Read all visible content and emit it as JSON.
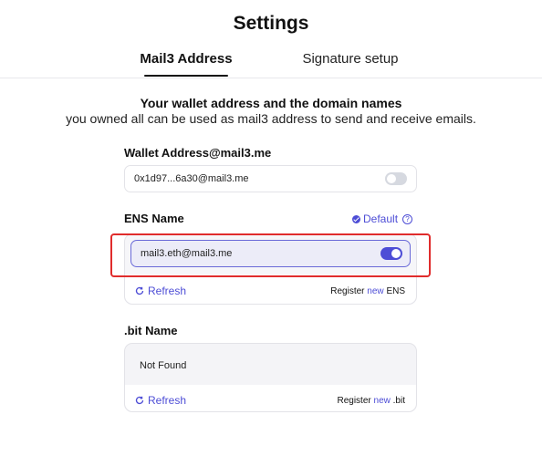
{
  "header": {
    "title": "Settings"
  },
  "tabs": [
    {
      "label": "Mail3 Address",
      "active": true
    },
    {
      "label": "Signature setup",
      "active": false
    }
  ],
  "intro": {
    "title": "Your wallet address and the domain names",
    "subtitle": "you owned all can be used as mail3 address to send and receive emails."
  },
  "wallet": {
    "label": "Wallet Address@mail3.me",
    "address": "0x1d97...6a30@mail3.me",
    "toggle_on": false
  },
  "ens": {
    "label": "ENS Name",
    "default_label": "Default",
    "address": "mail3.eth@mail3.me",
    "toggle_on": true,
    "refresh_label": "Refresh",
    "register_prefix": "Register",
    "register_new": "new",
    "register_suffix": "ENS"
  },
  "bit": {
    "label": ".bit Name",
    "status": "Not Found",
    "refresh_label": "Refresh",
    "register_prefix": "Register",
    "register_new": "new",
    "register_suffix": ".bit"
  },
  "colors": {
    "accent": "#4d4dd6",
    "highlight": "#e02c2c",
    "toggle_off": "#d6d9e0"
  }
}
